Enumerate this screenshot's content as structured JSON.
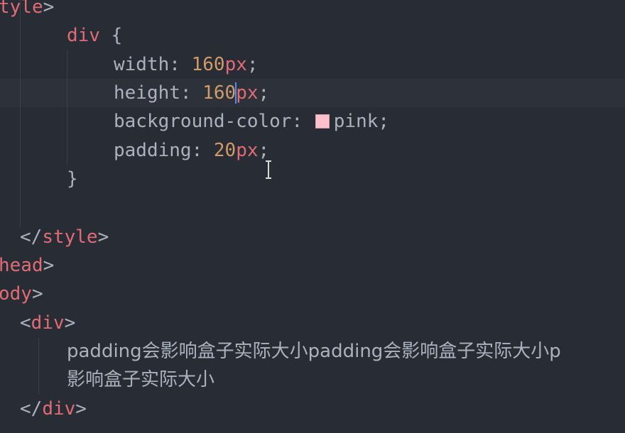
{
  "editor": {
    "lines": {
      "style_open": {
        "tag": "tyle",
        "close": ">"
      },
      "selector": {
        "name": "div",
        "brace": "{"
      },
      "width": {
        "prop": "width",
        "colon": ": ",
        "num": "160",
        "unit": "px",
        "semi": ";"
      },
      "height": {
        "prop": "height",
        "colon": ": ",
        "num": "160",
        "unit": "px",
        "semi": ";"
      },
      "bg": {
        "prop": "background-color",
        "colon": ": ",
        "value": "pink",
        "semi": ";",
        "swatch_color": "#ffc0cb"
      },
      "padding": {
        "prop": "padding",
        "colon": ": ",
        "num": "20",
        "unit": "px",
        "semi": ";"
      },
      "close_brace": "}",
      "style_close": {
        "open": "</",
        "tag": "style",
        "close": ">"
      },
      "head_close": {
        "tag": "head",
        "close": ">"
      },
      "body_open": {
        "tag": "ody",
        "close": ">"
      },
      "div_open": {
        "open": "<",
        "tag": "div",
        "close": ">"
      },
      "text1": "padding会影响盒子实际大小padding会影响盒子实际大小p",
      "text2": "影响盒子实际大小",
      "div_close": {
        "open": "</",
        "tag": "div",
        "close": ">"
      }
    }
  },
  "colors": {
    "background": "#282c34",
    "tag": "#e06c75",
    "number": "#d19a66",
    "text": "#abb2bf",
    "caret": "#528bff"
  }
}
